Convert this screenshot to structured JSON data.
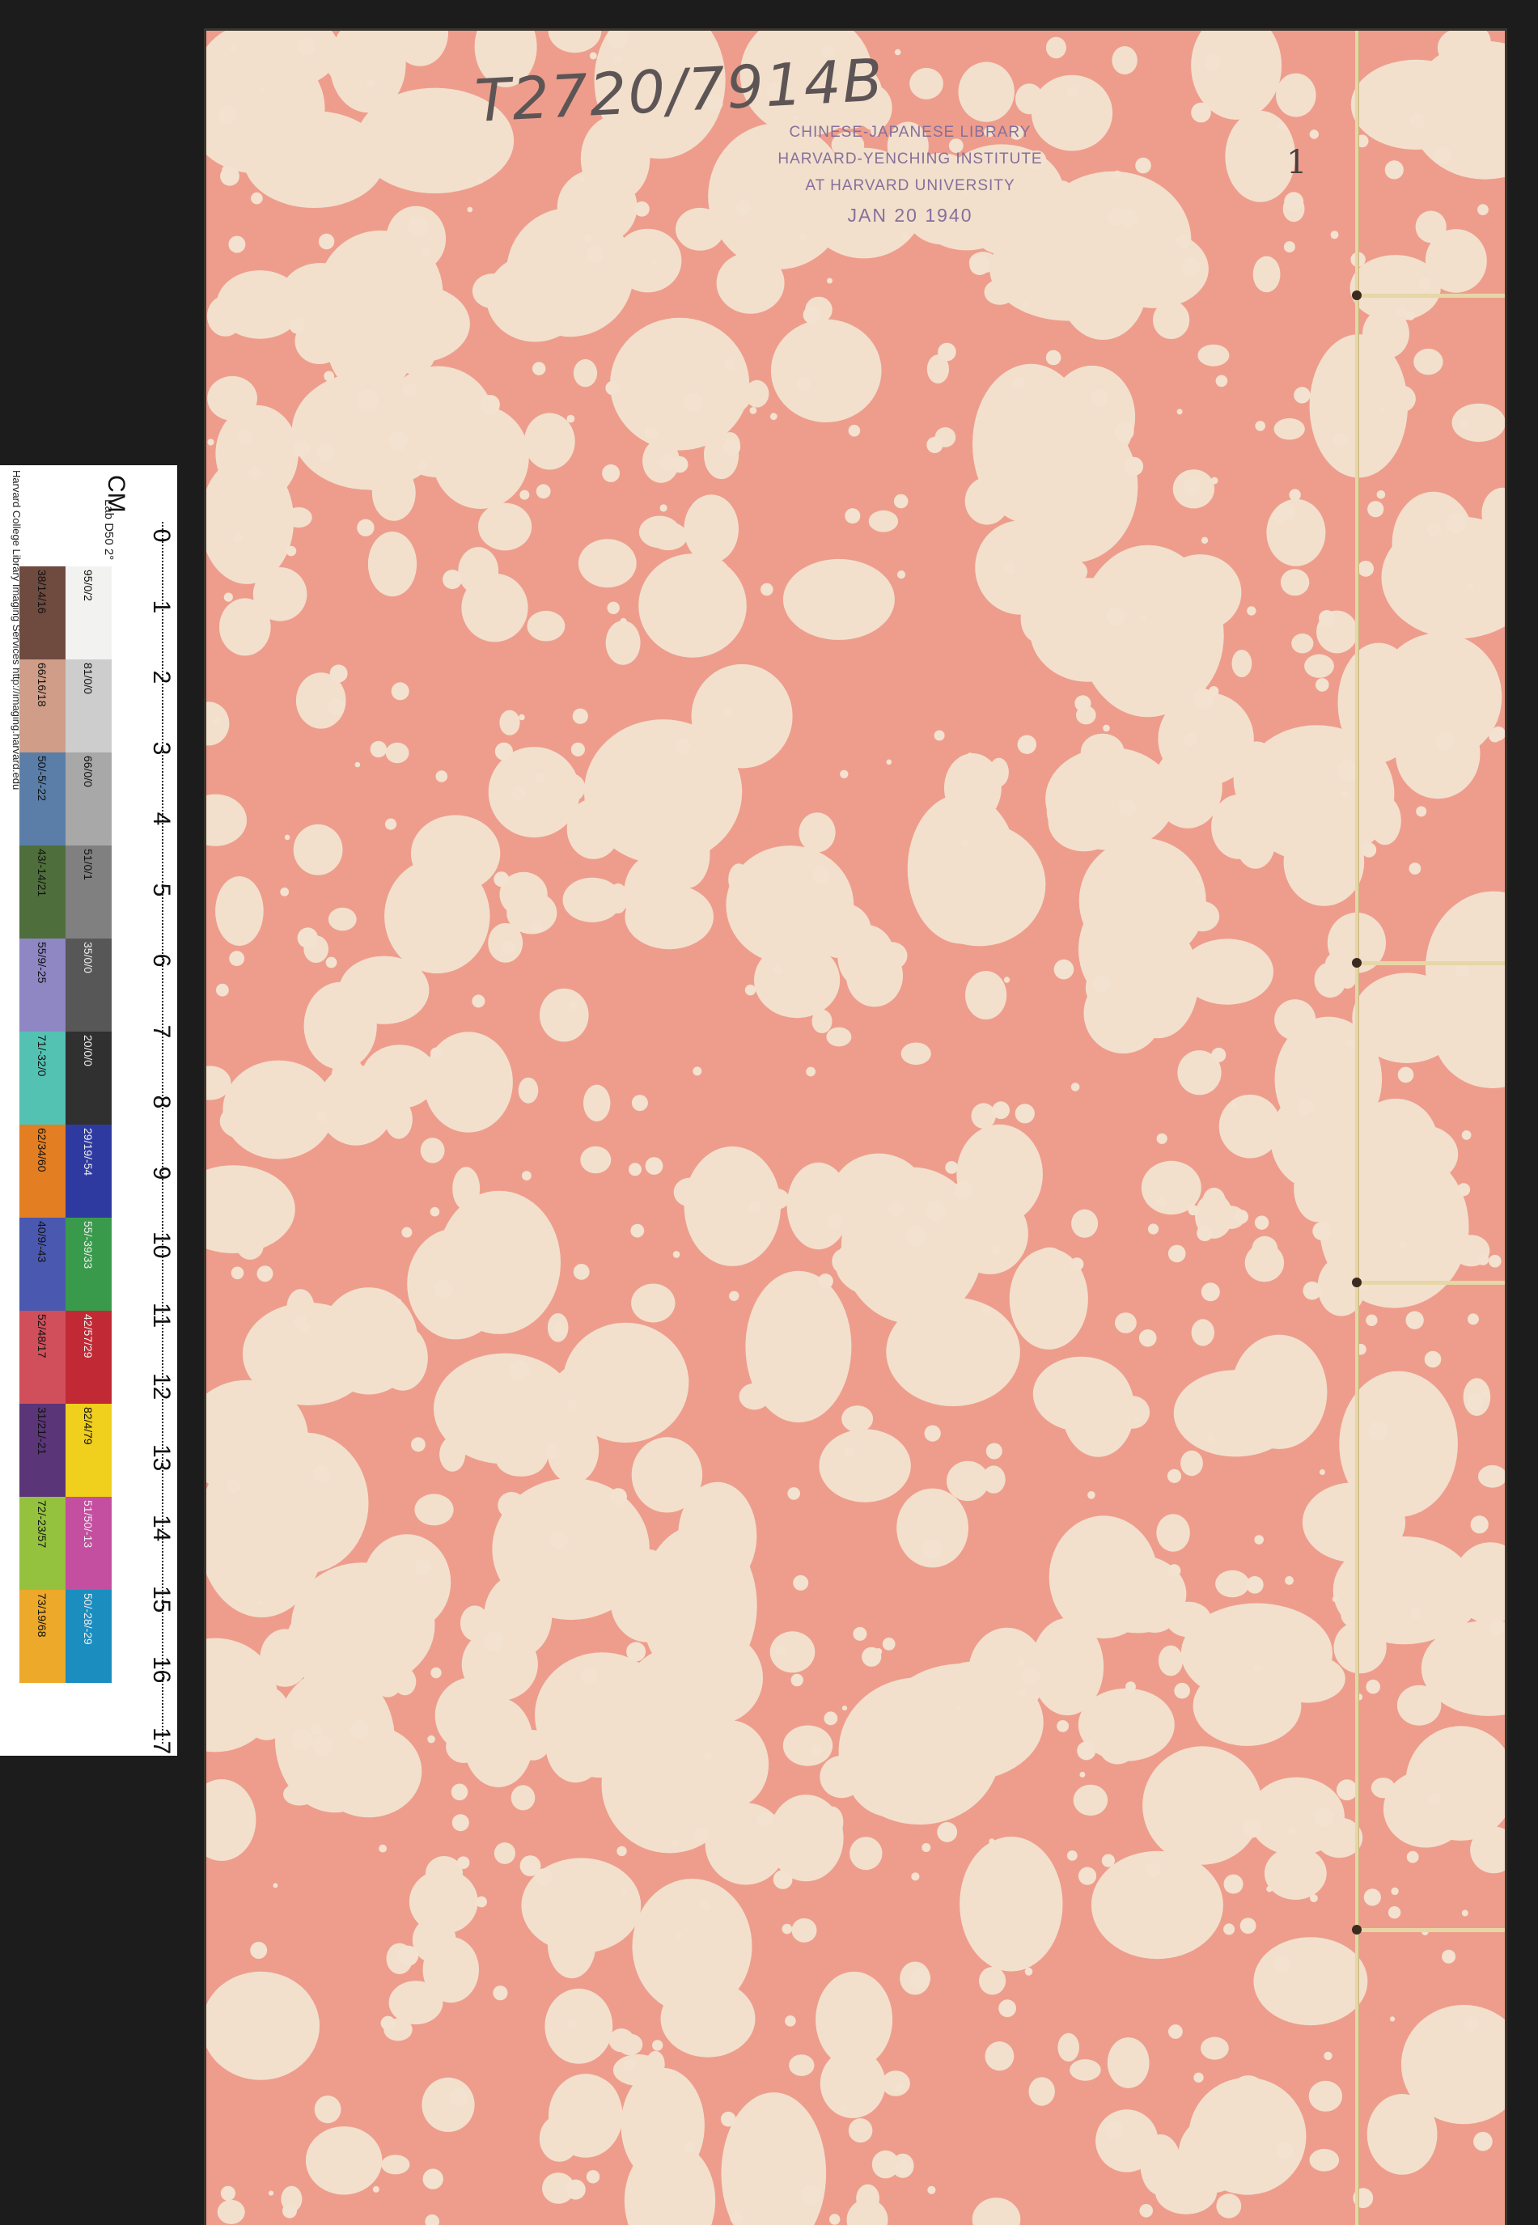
{
  "call_number": "T2720/7914B",
  "stamp": {
    "line1": "CHINESE-JAPANESE LIBRARY",
    "line2": "HARVARD-YENCHING INSTITUTE",
    "line3": "AT HARVARD UNIVERSITY",
    "date": "JAN 20 1940"
  },
  "page_number": "1",
  "color_scale": {
    "unit_label": "CM",
    "lab_label": "Lab D50 2°",
    "credit": "Harvard College Library Imaging Services http://imaging.harvard.edu",
    "gray_row": [
      "95/0/2",
      "81/0/0",
      "66/0/0",
      "51/0/1",
      "35/0/0",
      "20/0/0",
      "29/19/-54",
      "55/-39/33",
      "42/57/29",
      "82/4/79",
      "51/50/-13",
      "50/-28/-29"
    ],
    "color_row": [
      "38/14/16",
      "66/16/18",
      "50/-5/-22",
      "43/-14/21",
      "55/9/-25",
      "71/-32/0",
      "62/34/60",
      "40/9/-43",
      "52/48/17",
      "31/21/-21",
      "72/-23/57",
      "73/19/68"
    ],
    "gray_colors": [
      "#f2f2f0",
      "#cdcdcd",
      "#a8a8a8",
      "#808080",
      "#575757",
      "#303030",
      "#2f3aa1",
      "#3a9a4c",
      "#c12a34",
      "#f0cf1d",
      "#c44ea0",
      "#1b8dbf"
    ],
    "color_colors": [
      "#6f4a3f",
      "#cf9d88",
      "#5a7ea8",
      "#4e6e3c",
      "#8f86c4",
      "#54c2b3",
      "#e37f22",
      "#4b58b0",
      "#d04f5a",
      "#5a3577",
      "#95c23e",
      "#eda92a"
    ],
    "cm_ticks": [
      "0",
      "1",
      "2",
      "3",
      "4",
      "5",
      "6",
      "7",
      "8",
      "9",
      "10",
      "11",
      "12",
      "13",
      "14",
      "15",
      "16",
      "17"
    ]
  }
}
